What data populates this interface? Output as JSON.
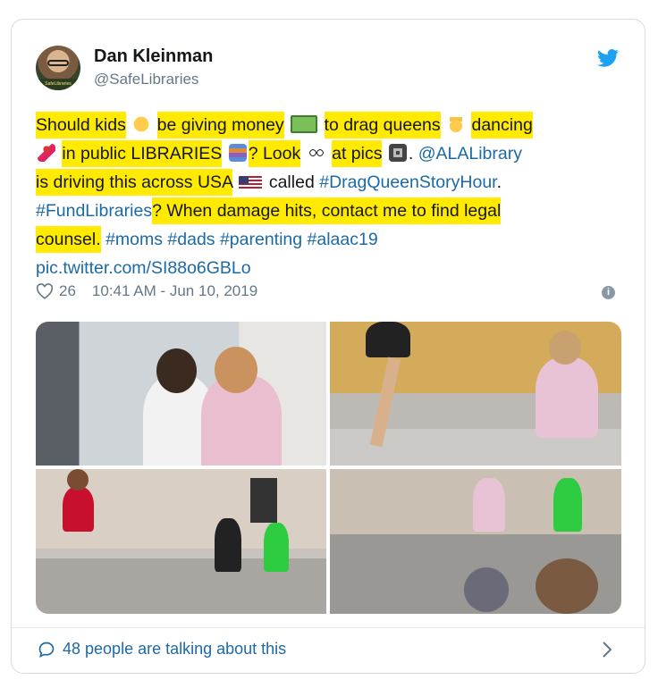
{
  "author": {
    "name": "Dan Kleinman",
    "handle": "@SafeLibraries",
    "avatar_caption": "SafeLibraries"
  },
  "tweet": {
    "seg1": "Should kids",
    "seg2": "be giving money",
    "seg3": "to drag queens",
    "seg4": "dancing",
    "seg5": "in public LIBRARIES",
    "seg6": "? Look",
    "seg7": "at pics",
    "seg8": ". ",
    "mention": "@ALALibrary",
    "seg9": "is driving this across USA",
    "seg10": " called ",
    "hashtag_story": "#DragQueenStoryHour",
    "seg11": ".",
    "hashtag_fund": "#FundLibraries",
    "seg12": "? When damage hits, contact me to find legal",
    "seg13": "counsel.",
    "hashtags_tail": "#moms #dads #parenting #alaac19",
    "pic_link": "pic.twitter.com/SI88o6GBLo",
    "emojis": [
      "child-face",
      "money-bill",
      "princess",
      "dancer",
      "books",
      "eyes",
      "camera",
      "us-flag"
    ]
  },
  "meta": {
    "likes": "26",
    "timestamp": "10:41 AM - Jun 10, 2019"
  },
  "footer": {
    "talking": "48 people are talking about this"
  },
  "colors": {
    "highlight": "#ffea00",
    "link": "#1b6aa5",
    "brand": "#1da1f2",
    "muted": "#657786"
  },
  "icons": [
    "twitter-bird-icon",
    "heart-icon",
    "info-icon",
    "comment-bubble-icon",
    "chevron-right-icon"
  ]
}
